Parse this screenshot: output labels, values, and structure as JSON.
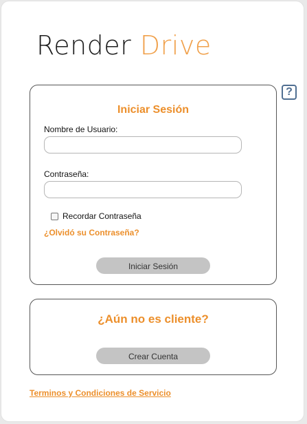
{
  "logo": {
    "word1": "Render",
    "word2": "Drive"
  },
  "help": {
    "icon": "help-icon",
    "glyph": "?"
  },
  "login": {
    "title": "Iniciar Sesión",
    "username_label": "Nombre de Usuario:",
    "username_value": "",
    "password_label": "Contraseña:",
    "password_value": "",
    "remember_label": "Recordar Contraseña",
    "remember_checked": false,
    "forgot_link": "¿Olvidó su Contraseña?",
    "submit_label": "Iniciar Sesión"
  },
  "signup": {
    "title": "¿Aún no es cliente?",
    "create_label": "Crear Cuenta"
  },
  "footer": {
    "terms_link": "Terminos y Condiciones de Servicio"
  },
  "colors": {
    "accent": "#ec8f2b",
    "logo_accent": "#f0a04a",
    "help_icon": "#4f6e91",
    "button_bg": "#c4c4c4"
  }
}
